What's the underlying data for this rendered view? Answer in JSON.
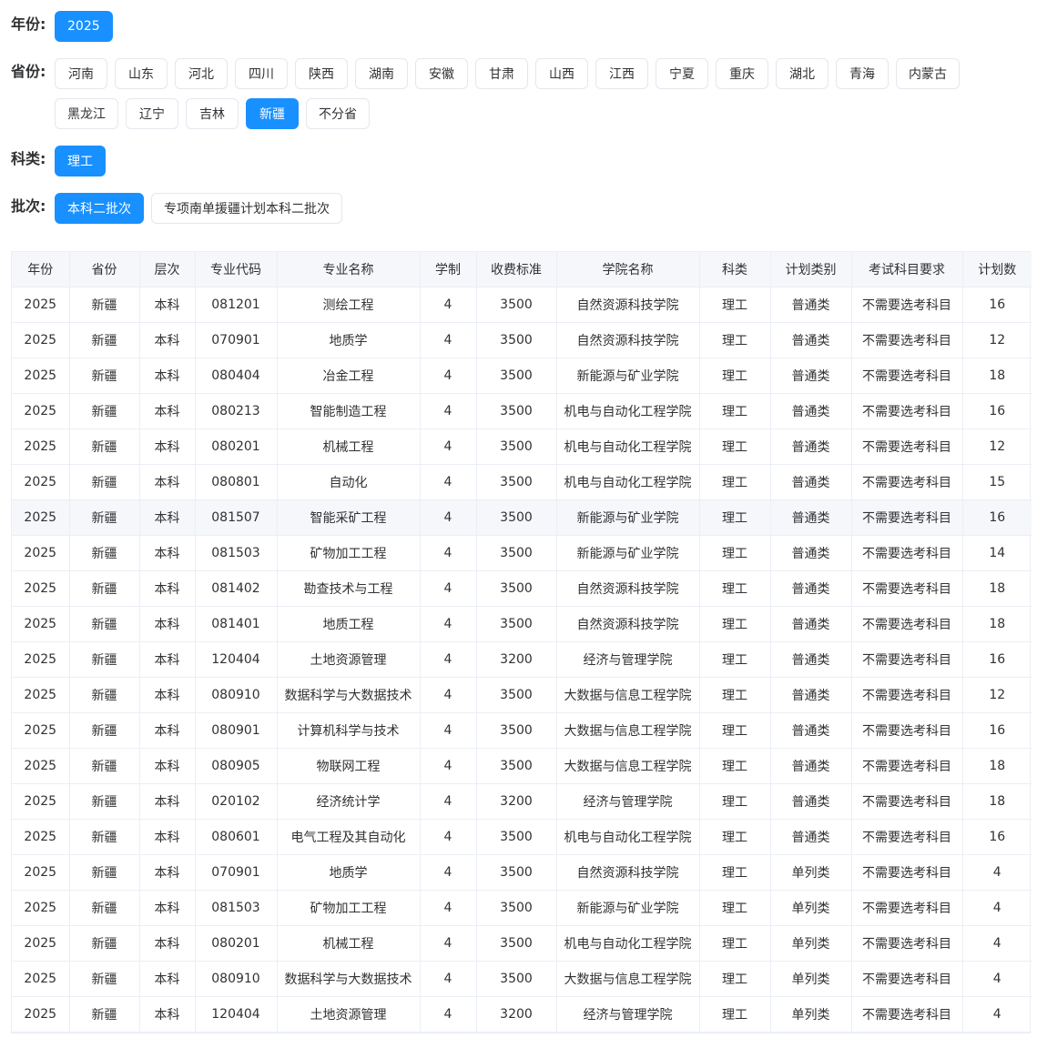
{
  "filters": {
    "year": {
      "label": "年份:",
      "options": [
        "2025"
      ],
      "active": 0
    },
    "province": {
      "label": "省份:",
      "options": [
        "河南",
        "山东",
        "河北",
        "四川",
        "陕西",
        "湖南",
        "安徽",
        "甘肃",
        "山西",
        "江西",
        "宁夏",
        "重庆",
        "湖北",
        "青海",
        "内蒙古",
        "黑龙江",
        "辽宁",
        "吉林",
        "新疆",
        "不分省"
      ],
      "active": 18
    },
    "category": {
      "label": "科类:",
      "options": [
        "理工"
      ],
      "active": 0
    },
    "batch": {
      "label": "批次:",
      "options": [
        "本科二批次",
        "专项南单援疆计划本科二批次"
      ],
      "active": 0
    }
  },
  "table": {
    "columns": [
      "年份",
      "省份",
      "层次",
      "专业代码",
      "专业名称",
      "学制",
      "收费标准",
      "学院名称",
      "科类",
      "计划类别",
      "考试科目要求",
      "计划数"
    ],
    "highlight_row": 6,
    "rows": [
      [
        "2025",
        "新疆",
        "本科",
        "081201",
        "测绘工程",
        "4",
        "3500",
        "自然资源科技学院",
        "理工",
        "普通类",
        "不需要选考科目",
        "16"
      ],
      [
        "2025",
        "新疆",
        "本科",
        "070901",
        "地质学",
        "4",
        "3500",
        "自然资源科技学院",
        "理工",
        "普通类",
        "不需要选考科目",
        "12"
      ],
      [
        "2025",
        "新疆",
        "本科",
        "080404",
        "冶金工程",
        "4",
        "3500",
        "新能源与矿业学院",
        "理工",
        "普通类",
        "不需要选考科目",
        "18"
      ],
      [
        "2025",
        "新疆",
        "本科",
        "080213",
        "智能制造工程",
        "4",
        "3500",
        "机电与自动化工程学院",
        "理工",
        "普通类",
        "不需要选考科目",
        "16"
      ],
      [
        "2025",
        "新疆",
        "本科",
        "080201",
        "机械工程",
        "4",
        "3500",
        "机电与自动化工程学院",
        "理工",
        "普通类",
        "不需要选考科目",
        "12"
      ],
      [
        "2025",
        "新疆",
        "本科",
        "080801",
        "自动化",
        "4",
        "3500",
        "机电与自动化工程学院",
        "理工",
        "普通类",
        "不需要选考科目",
        "15"
      ],
      [
        "2025",
        "新疆",
        "本科",
        "081507",
        "智能采矿工程",
        "4",
        "3500",
        "新能源与矿业学院",
        "理工",
        "普通类",
        "不需要选考科目",
        "16"
      ],
      [
        "2025",
        "新疆",
        "本科",
        "081503",
        "矿物加工工程",
        "4",
        "3500",
        "新能源与矿业学院",
        "理工",
        "普通类",
        "不需要选考科目",
        "14"
      ],
      [
        "2025",
        "新疆",
        "本科",
        "081402",
        "勘查技术与工程",
        "4",
        "3500",
        "自然资源科技学院",
        "理工",
        "普通类",
        "不需要选考科目",
        "18"
      ],
      [
        "2025",
        "新疆",
        "本科",
        "081401",
        "地质工程",
        "4",
        "3500",
        "自然资源科技学院",
        "理工",
        "普通类",
        "不需要选考科目",
        "18"
      ],
      [
        "2025",
        "新疆",
        "本科",
        "120404",
        "土地资源管理",
        "4",
        "3200",
        "经济与管理学院",
        "理工",
        "普通类",
        "不需要选考科目",
        "16"
      ],
      [
        "2025",
        "新疆",
        "本科",
        "080910",
        "数据科学与大数据技术",
        "4",
        "3500",
        "大数据与信息工程学院",
        "理工",
        "普通类",
        "不需要选考科目",
        "12"
      ],
      [
        "2025",
        "新疆",
        "本科",
        "080901",
        "计算机科学与技术",
        "4",
        "3500",
        "大数据与信息工程学院",
        "理工",
        "普通类",
        "不需要选考科目",
        "16"
      ],
      [
        "2025",
        "新疆",
        "本科",
        "080905",
        "物联网工程",
        "4",
        "3500",
        "大数据与信息工程学院",
        "理工",
        "普通类",
        "不需要选考科目",
        "18"
      ],
      [
        "2025",
        "新疆",
        "本科",
        "020102",
        "经济统计学",
        "4",
        "3200",
        "经济与管理学院",
        "理工",
        "普通类",
        "不需要选考科目",
        "18"
      ],
      [
        "2025",
        "新疆",
        "本科",
        "080601",
        "电气工程及其自动化",
        "4",
        "3500",
        "机电与自动化工程学院",
        "理工",
        "普通类",
        "不需要选考科目",
        "16"
      ],
      [
        "2025",
        "新疆",
        "本科",
        "070901",
        "地质学",
        "4",
        "3500",
        "自然资源科技学院",
        "理工",
        "单列类",
        "不需要选考科目",
        "4"
      ],
      [
        "2025",
        "新疆",
        "本科",
        "081503",
        "矿物加工工程",
        "4",
        "3500",
        "新能源与矿业学院",
        "理工",
        "单列类",
        "不需要选考科目",
        "4"
      ],
      [
        "2025",
        "新疆",
        "本科",
        "080201",
        "机械工程",
        "4",
        "3500",
        "机电与自动化工程学院",
        "理工",
        "单列类",
        "不需要选考科目",
        "4"
      ],
      [
        "2025",
        "新疆",
        "本科",
        "080910",
        "数据科学与大数据技术",
        "4",
        "3500",
        "大数据与信息工程学院",
        "理工",
        "单列类",
        "不需要选考科目",
        "4"
      ],
      [
        "2025",
        "新疆",
        "本科",
        "120404",
        "土地资源管理",
        "4",
        "3200",
        "经济与管理学院",
        "理工",
        "单列类",
        "不需要选考科目",
        "4"
      ]
    ]
  }
}
